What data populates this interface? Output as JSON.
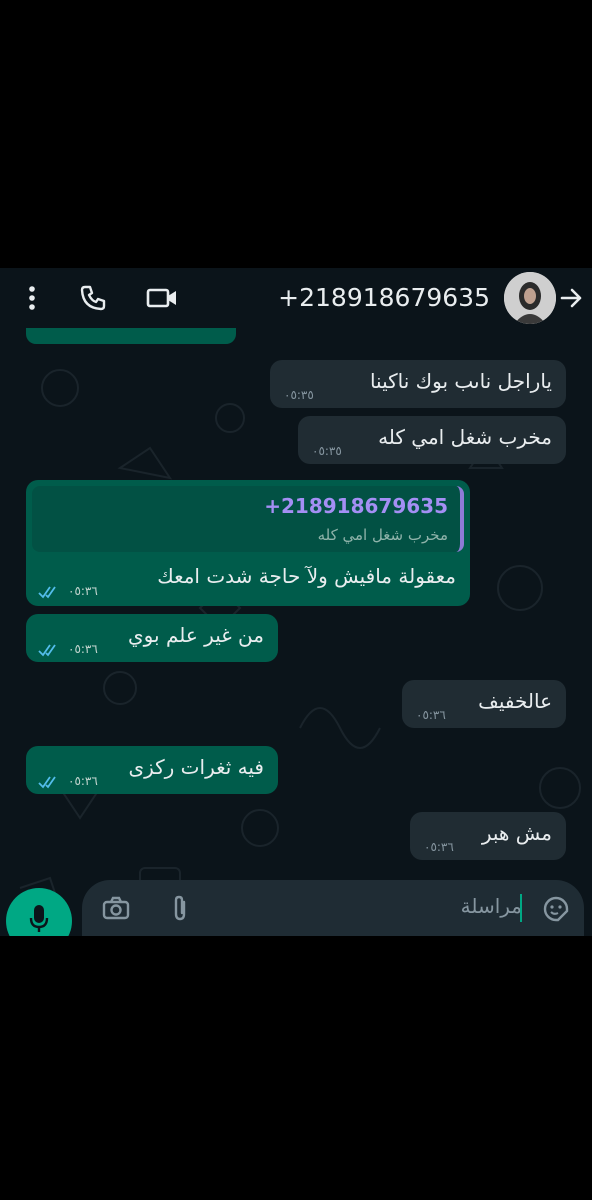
{
  "header": {
    "contact_title": "+218918679635",
    "icons": [
      "back-arrow-icon",
      "video-call-icon",
      "voice-call-icon",
      "more-options-icon"
    ]
  },
  "messages": [
    {
      "direction": "incoming",
      "text": "ياراجل ناىب بوك ناكينا",
      "time": "٠٥:٣٥"
    },
    {
      "direction": "incoming",
      "text": "مخرب شغل امي كله",
      "time": "٠٥:٣٥"
    },
    {
      "direction": "outgoing",
      "reply_to": {
        "name": "+218918679635",
        "text": "مخرب شغل امي كله"
      },
      "text": "معقولة مافيش ولآ حاجة شدت امعك",
      "time": "٠٥:٣٦",
      "status": "read"
    },
    {
      "direction": "outgoing",
      "text": "من غير علم بوي",
      "time": "٠٥:٣٦",
      "status": "read"
    },
    {
      "direction": "incoming",
      "text": "عالخفيف",
      "time": "٠٥:٣٦"
    },
    {
      "direction": "outgoing",
      "text": "فيه ثغرات ركزى",
      "time": "٠٥:٣٦",
      "status": "read"
    },
    {
      "direction": "incoming",
      "text": "مش هبر",
      "time": "٠٥:٣٦"
    }
  ],
  "composer": {
    "placeholder": "مراسلة",
    "icons": [
      "sticker-icon",
      "attach-icon",
      "camera-icon",
      "mic-icon"
    ]
  },
  "colors": {
    "chat_background": "#0b141a",
    "incoming_bubble": "#202c33",
    "outgoing_bubble": "#005c4b",
    "accent": "#00a884",
    "read_ticks": "#53bdeb"
  }
}
